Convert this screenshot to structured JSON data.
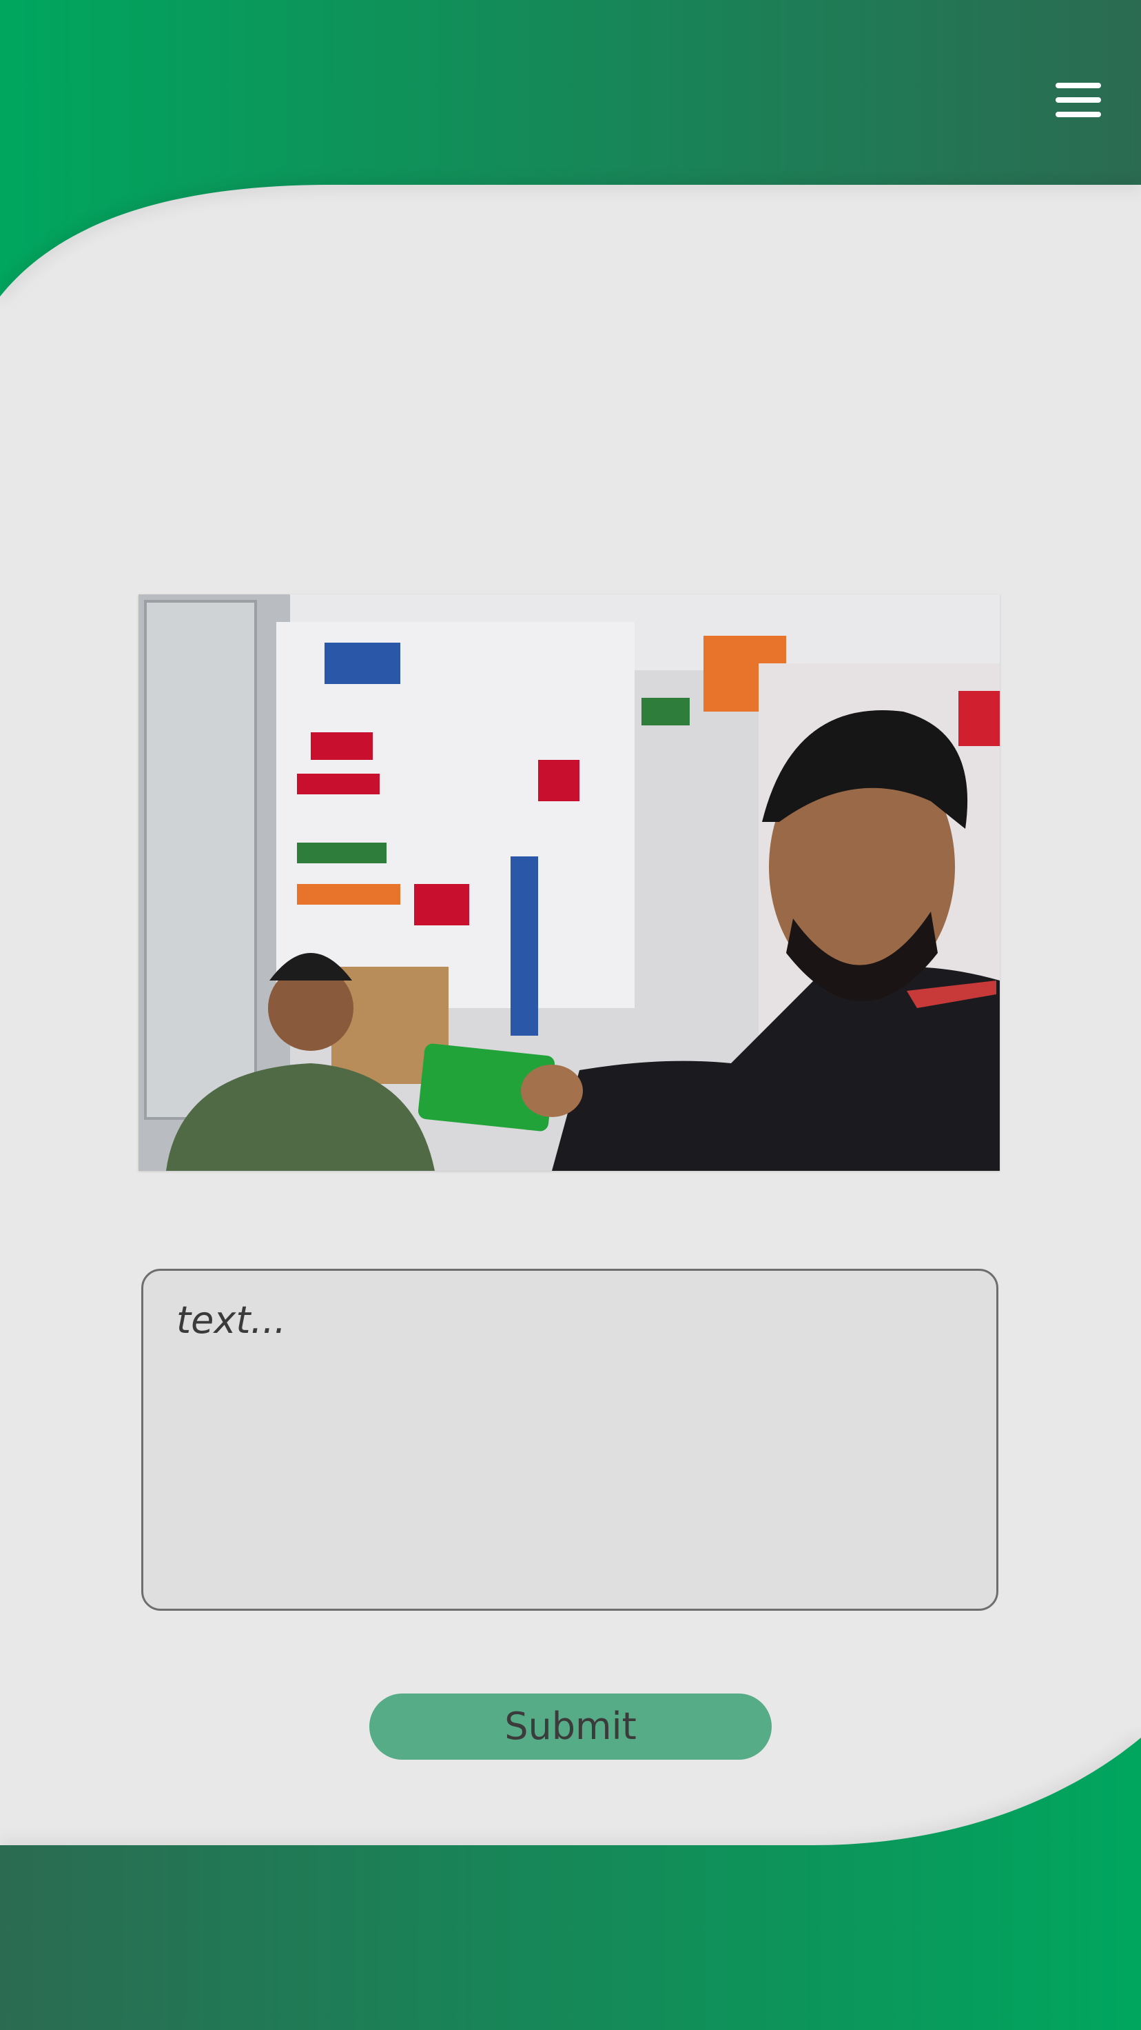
{
  "header": {
    "menu_icon": "hamburger-menu-icon"
  },
  "photo": {
    "description_icon": "store-selfie-photo"
  },
  "form": {
    "text_placeholder": "text...",
    "text_value": "",
    "submit_label": "Submit"
  },
  "colors": {
    "brand_green": "#00a65e",
    "dark_green": "#2b6b52",
    "background": "#e8e8e8",
    "button_green": "#55ac87"
  }
}
